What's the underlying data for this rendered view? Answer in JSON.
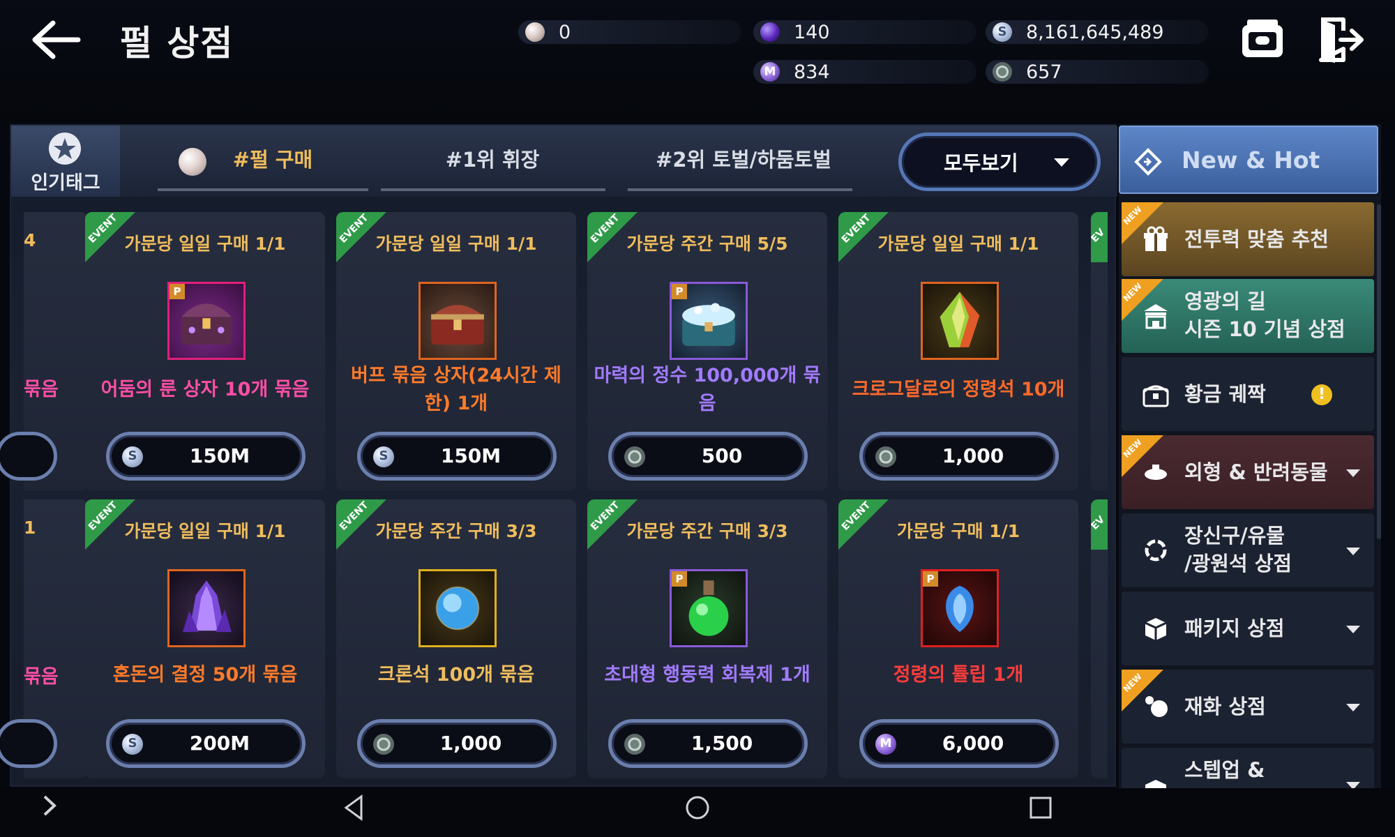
{
  "header": {
    "title": "펄 상점"
  },
  "currencies": [
    {
      "name": "pearl",
      "value": "0"
    },
    {
      "name": "purple-gem",
      "value": "140"
    },
    {
      "name": "silver",
      "value": "8,161,645,489"
    },
    {
      "name": "m-coin",
      "value": "834"
    },
    {
      "name": "emblem",
      "value": "657"
    }
  ],
  "tabs": {
    "popular_tag_label": "인기태그",
    "items": [
      "#펄 구매",
      "#1위 휘장",
      "#2위 토벌/하둠토벌"
    ],
    "view_all": "모두보기"
  },
  "cards": [
    {
      "limit": "가문당 일일 구매 1/1",
      "name": "어둠의 룬 상자 10개 묶음",
      "price": "150M",
      "currency": "silver",
      "name_color": "#ff4fa6",
      "event": "EVENT"
    },
    {
      "limit": "가문당 일일 구매 1/1",
      "name": "버프 묶음 상자(24시간 제한) 1개",
      "price": "150M",
      "currency": "silver",
      "name_color": "#ff7b2a",
      "event": "EVENT"
    },
    {
      "limit": "가문당 주간 구매 5/5",
      "name": "마력의 정수 100,000개 묶음",
      "price": "500",
      "currency": "emblem",
      "name_color": "#a27bff",
      "event": "EVENT"
    },
    {
      "limit": "가문당 일일 구매 1/1",
      "name": "크로그달로의 정령석 10개",
      "price": "1,000",
      "currency": "emblem",
      "name_color": "#ff6a2a",
      "event": "EVENT"
    },
    {
      "limit": "가문당 일일 구매 1/1",
      "name": "혼돈의 결정 50개 묶음",
      "price": "200M",
      "currency": "silver",
      "name_color": "#ff7b2a",
      "event": "EVENT"
    },
    {
      "limit": "가문당 주간 구매 3/3",
      "name": "크론석 100개 묶음",
      "price": "1,000",
      "currency": "emblem",
      "name_color": "#f0bd5d",
      "event": "EVENT"
    },
    {
      "limit": "가문당 주간 구매 3/3",
      "name": "초대형 행동력 회복제 1개",
      "price": "1,500",
      "currency": "emblem",
      "name_color": "#a27bff",
      "event": "EVENT"
    },
    {
      "limit": "가문당 구매 1/1",
      "name": "정령의 튤립 1개",
      "price": "6,000",
      "currency": "m-coin",
      "name_color": "#ff3c3c",
      "event": "EVENT"
    }
  ],
  "partial_cards": {
    "row1_limit": "4",
    "row1_name": "묶음",
    "row2_limit": "1",
    "row2_name": "묶음",
    "edge_event": "EV"
  },
  "sidebar": {
    "header": "New & Hot",
    "new_tag": "NEW",
    "items": [
      {
        "label": "전투력 맞춤 추천"
      },
      {
        "label": "영광의 길",
        "label2": "시즌 10 기념 상점"
      },
      {
        "label": "황금 궤짝"
      },
      {
        "label": "외형 & 반려동물"
      },
      {
        "label": "장신구/유물",
        "label2": "/광원석 상점"
      },
      {
        "label": "패키지 상점"
      },
      {
        "label": "재화 상점"
      },
      {
        "label": "스텝업 &"
      }
    ]
  },
  "colors": {
    "accent_blue": "#5577b8",
    "limit_gold": "#f0bd5d",
    "event_green": "#2f9a48"
  }
}
